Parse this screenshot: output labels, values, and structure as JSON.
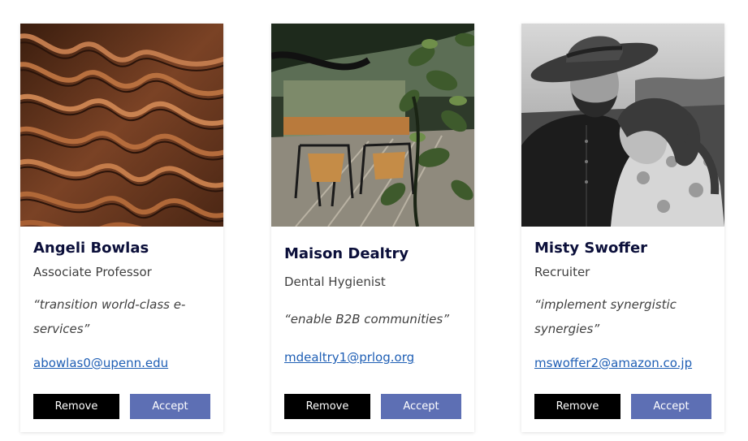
{
  "cards": [
    {
      "name": "Angeli Bowlas",
      "title": "Associate Professor",
      "quote": "“transition world-class e-services”",
      "email": "abowlas0@upenn.edu",
      "image": "sand-dunes-photo",
      "remove_label": "Remove",
      "accept_label": "Accept"
    },
    {
      "name": "Maison Dealtry",
      "title": "Dental Hygienist",
      "quote": "“enable B2B communities”",
      "email": "mdealtry1@prlog.org",
      "image": "patio-chairs-photo",
      "remove_label": "Remove",
      "accept_label": "Accept"
    },
    {
      "name": "Misty Swoffer",
      "title": "Recruiter",
      "quote": "“implement synergistic synergies”",
      "email": "mswoffer2@amazon.co.jp",
      "image": "couple-portrait-photo",
      "remove_label": "Remove",
      "accept_label": "Accept"
    }
  ],
  "colors": {
    "name": "#0b0f3a",
    "text": "#3f3f3f",
    "link": "#1f5fb5",
    "remove_button": "#000000",
    "accept_button": "#5d6fb4"
  }
}
